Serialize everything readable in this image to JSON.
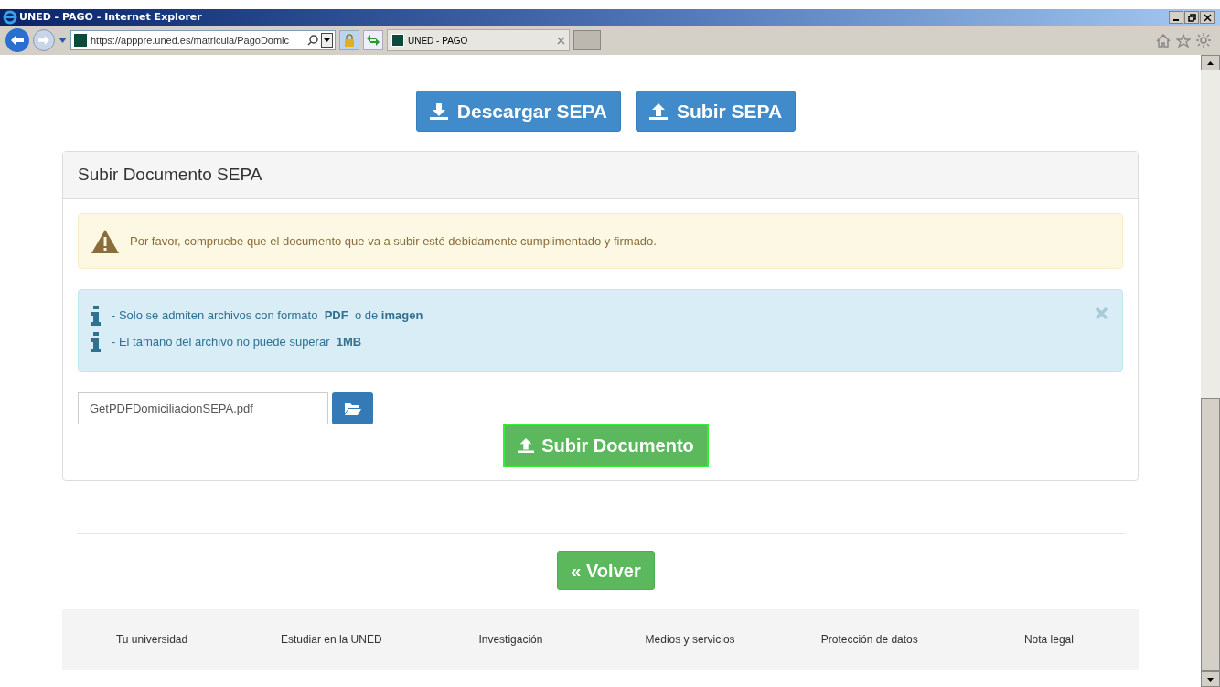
{
  "window": {
    "title": "UNED - PAGO - Internet Explorer"
  },
  "address_bar": {
    "url": "https://apppre.uned.es/matricula/PagoDomic"
  },
  "tabs": [
    {
      "label": "UNED - PAGO",
      "selected": true
    }
  ],
  "top_buttons": [
    {
      "kind": "download",
      "label": "Descargar SEPA"
    },
    {
      "kind": "upload",
      "label": "Subir SEPA"
    }
  ],
  "panel": {
    "title": "Subir Documento SEPA",
    "warning": "Por favor, compruebe que el documento que va a subir esté debidamente cumplimentado y firmado.",
    "info_lines": [
      "- Solo se admiten archivos con formato  **PDF**  o de **imagen**",
      "- El tamaño del archivo no puede superar  **1MB**"
    ],
    "file_field": {
      "value": "GetPDFDomiciliacionSEPA.pdf"
    },
    "submit_button": "Subir Documento"
  },
  "back_button": "« Volver",
  "footer_links": [
    "Tu universidad",
    "Estudiar en la UNED",
    "Investigación",
    "Medios y servicios",
    "Protección de datos",
    "Nota legal"
  ]
}
